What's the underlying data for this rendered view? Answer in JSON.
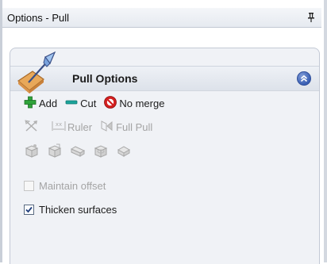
{
  "window": {
    "title": "Options - Pull",
    "pin_icon": "pin-icon"
  },
  "panel": {
    "title": "Pull Options",
    "tool_icon": "pull-tool-icon",
    "collapse_icon": "collapse-chevron-icon"
  },
  "actions": {
    "add_label": "Add",
    "cut_label": "Cut",
    "no_merge_label": "No merge"
  },
  "tools": {
    "ruler_label": "Ruler",
    "full_pull_label": "Full Pull"
  },
  "options": {
    "maintain_offset_label": "Maintain offset",
    "maintain_offset_checked": false,
    "maintain_offset_enabled": false,
    "thicken_surfaces_label": "Thicken surfaces",
    "thicken_surfaces_checked": true
  },
  "colors": {
    "add_green": "#2fa33a",
    "cut_teal": "#1aa39a",
    "no_merge_red": "#d32020",
    "accent_blue": "#3a5fb4",
    "panel_bg": "#f0f2f6"
  }
}
